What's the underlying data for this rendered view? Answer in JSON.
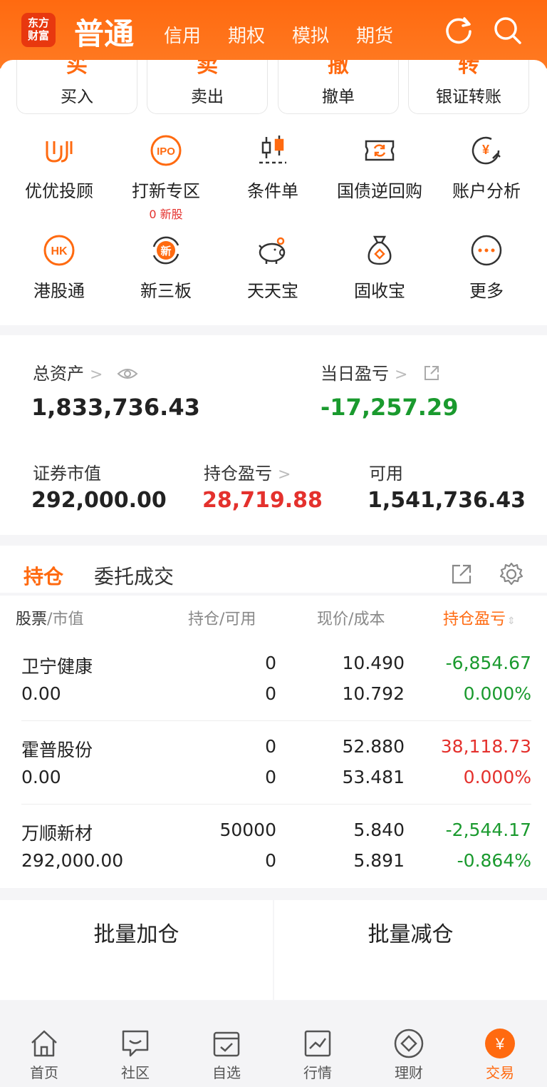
{
  "header": {
    "logo_line1": "东方",
    "logo_line2": "财富",
    "active_tab": "普通",
    "tabs": [
      "信用",
      "期权",
      "模拟",
      "期货"
    ],
    "refresh_icon": "refresh-icon",
    "search_icon": "search-icon"
  },
  "actions": [
    {
      "partial": "买",
      "label": "买入"
    },
    {
      "partial": "卖",
      "label": "卖出"
    },
    {
      "partial": "撤",
      "label": "撤单"
    },
    {
      "partial": "转",
      "label": "银证转账"
    }
  ],
  "features_row1": [
    {
      "label": "优优投顾",
      "icon": "advisor-icon"
    },
    {
      "label": "打新专区",
      "icon": "ipo-icon",
      "sub": "0 新股"
    },
    {
      "label": "条件单",
      "icon": "candlestick-icon"
    },
    {
      "label": "国债逆回购",
      "icon": "repo-icon"
    },
    {
      "label": "账户分析",
      "icon": "yuan-chart-icon"
    }
  ],
  "features_row2": [
    {
      "label": "港股通",
      "icon": "hk-icon",
      "badge": "HK"
    },
    {
      "label": "新三板",
      "icon": "new-board-icon",
      "badge": "新"
    },
    {
      "label": "天天宝",
      "icon": "piggy-bank-icon"
    },
    {
      "label": "固收宝",
      "icon": "money-bag-icon"
    },
    {
      "label": "更多",
      "icon": "more-icon"
    }
  ],
  "ipo_badge": "IPO",
  "assets": {
    "total_label": "总资产",
    "total_value": "1,833,736.43",
    "daily_label": "当日盈亏",
    "daily_value": "-17,257.29",
    "market_label": "证券市值",
    "market_value": "292,000.00",
    "holding_pl_label": "持仓盈亏",
    "holding_pl_value": "28,719.88",
    "available_label": "可用",
    "available_value": "1,541,736.43"
  },
  "positions": {
    "tab_active": "持仓",
    "tab_other": "委托成交",
    "col1a": "股票",
    "col1b": "市值",
    "col2a": "持仓",
    "col2b": "可用",
    "col3a": "现价",
    "col3b": "成本",
    "col4": "持仓盈亏",
    "rows": [
      {
        "name": "卫宁健康",
        "value": "0.00",
        "hold": "0",
        "avail": "0",
        "price": "10.490",
        "cost": "10.792",
        "pl": "-6,854.67",
        "pct": "0.000%",
        "pl_color": "#1a9a2e",
        "pct_color": "#1a9a2e"
      },
      {
        "name": "霍普股份",
        "value": "0.00",
        "hold": "0",
        "avail": "0",
        "price": "52.880",
        "cost": "53.481",
        "pl": "38,118.73",
        "pct": "0.000%",
        "pl_color": "#e4312d",
        "pct_color": "#e4312d"
      },
      {
        "name": "万顺新材",
        "value": "292,000.00",
        "hold": "50000",
        "avail": "0",
        "price": "5.840",
        "cost": "5.891",
        "pl": "-2,544.17",
        "pct": "-0.864%",
        "pl_color": "#1a9a2e",
        "pct_color": "#1a9a2e"
      }
    ]
  },
  "batch_add": "批量加仓",
  "batch_reduce": "批量减仓",
  "nav": [
    {
      "label": "首页",
      "icon": "home-icon"
    },
    {
      "label": "社区",
      "icon": "community-icon"
    },
    {
      "label": "自选",
      "icon": "watchlist-icon"
    },
    {
      "label": "行情",
      "icon": "market-icon"
    },
    {
      "label": "理财",
      "icon": "wealth-icon"
    },
    {
      "label": "交易",
      "icon": "trade-icon",
      "active": true
    }
  ],
  "colors": {
    "brand": "#ff6a10",
    "up": "#e4312d",
    "down": "#1a9a2e"
  }
}
